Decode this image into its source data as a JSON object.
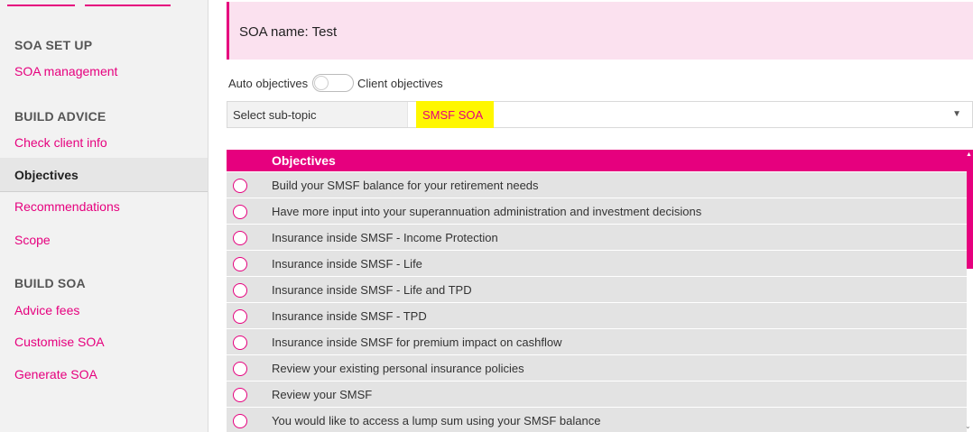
{
  "sidebar": {
    "sections": [
      {
        "heading": "SOA SET UP",
        "items": [
          "SOA management"
        ]
      },
      {
        "heading": "BUILD ADVICE",
        "items": [
          "Check client info",
          "Objectives",
          "Recommendations",
          "Scope"
        ]
      },
      {
        "heading": "BUILD SOA",
        "items": [
          "Advice fees",
          "Customise SOA",
          "Generate SOA"
        ]
      }
    ],
    "active_item": "Objectives"
  },
  "main": {
    "soa_name": "SOA name: Test",
    "toggle": {
      "left_label": "Auto objectives",
      "right_label": "Client objectives"
    },
    "subtopic": {
      "label": "Select sub-topic",
      "value": "SMSF SOA"
    },
    "objectives": {
      "header": "Objectives",
      "rows": [
        "Build your SMSF balance for your retirement needs",
        "Have more input into your superannuation administration and investment decisions",
        "Insurance inside SMSF - Income Protection",
        "Insurance inside SMSF - Life",
        "Insurance inside SMSF - Life and TPD",
        "Insurance inside SMSF - TPD",
        "Insurance inside SMSF for premium impact on cashflow",
        "Review your existing personal insurance policies",
        "Review your SMSF",
        "You would like to access a lump sum using your SMSF balance"
      ]
    }
  },
  "colors": {
    "accent": "#e6007e",
    "banner": "#fbe1ef",
    "highlight": "#fff700",
    "row_bg": "#e3e3e3"
  },
  "icons": [
    "chevron-down-icon",
    "radio-icon",
    "scroll-up-icon",
    "scroll-down-icon"
  ]
}
